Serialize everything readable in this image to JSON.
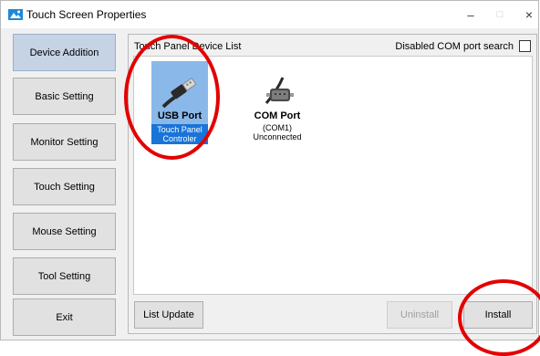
{
  "window": {
    "title": "Touch Screen Properties",
    "minimize": "–",
    "maximize": "□",
    "close": "×"
  },
  "nav": {
    "items": [
      {
        "label": "Device Addition",
        "active": true
      },
      {
        "label": "Basic Setting"
      },
      {
        "label": "Monitor Setting"
      },
      {
        "label": "Touch Setting"
      },
      {
        "label": "Mouse Setting"
      },
      {
        "label": "Tool Setting"
      },
      {
        "label": "Exit"
      }
    ]
  },
  "panel": {
    "title": "Touch Panel Device List",
    "com_search_label": "Disabled COM port search",
    "com_search_checked": false
  },
  "devices": {
    "usb": {
      "name": "USB Port",
      "line1": "Touch Panel",
      "line2": "Controler",
      "icon": "usb-cable-icon"
    },
    "com": {
      "name": "COM Port",
      "line1": "(COM1)",
      "line2": "Unconnected",
      "icon": "serial-cable-icon"
    }
  },
  "buttons": {
    "list_update": "List Update",
    "uninstall": "Uninstall",
    "install": "Install"
  },
  "colors": {
    "selection": "#1874d8",
    "selection_light": "#8ab8e8",
    "annotation_circle": "#e30000"
  }
}
